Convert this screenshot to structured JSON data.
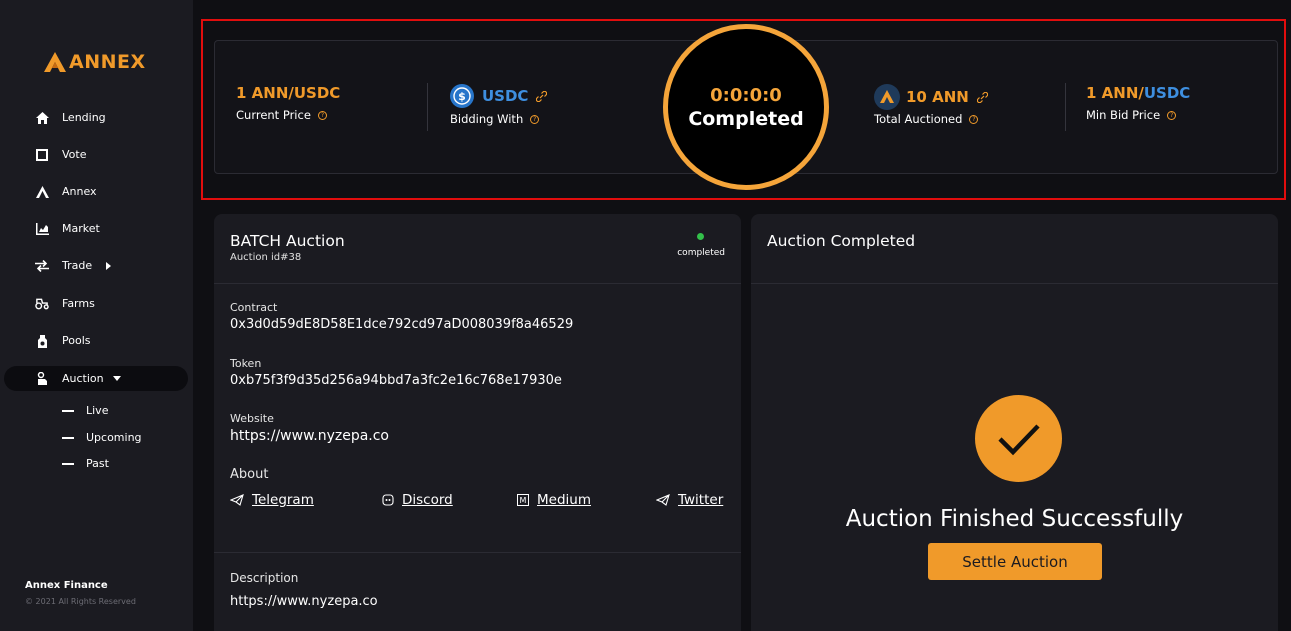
{
  "brand": {
    "name": "ANNEX"
  },
  "sidebar": {
    "items": [
      {
        "label": "Lending",
        "icon": "home-icon"
      },
      {
        "label": "Vote",
        "icon": "square-icon"
      },
      {
        "label": "Annex",
        "icon": "annex-logo-icon"
      },
      {
        "label": "Market",
        "icon": "chart-icon"
      },
      {
        "label": "Trade",
        "icon": "swap-icon"
      },
      {
        "label": "Farms",
        "icon": "tractor-icon"
      },
      {
        "label": "Pools",
        "icon": "pool-icon"
      },
      {
        "label": "Auction",
        "icon": "hand-icon"
      }
    ],
    "auction_sub": [
      "Live",
      "Upcoming",
      "Past"
    ],
    "footer_title": "Annex Finance",
    "footer_copy": "© 2021 All Rights Reserved"
  },
  "stats": {
    "current_price": {
      "value": "1 ANN/USDC",
      "label": "Current Price"
    },
    "bidding_with": {
      "value": "USDC",
      "label": "Bidding With"
    },
    "timer": {
      "time": "0:0:0:0",
      "status": "Completed"
    },
    "total_auctioned": {
      "value": "10 ANN",
      "label": "Total Auctioned"
    },
    "min_bid": {
      "value_orange": "1 ANN/",
      "value_blue": "USDC",
      "label": "Min Bid Price"
    }
  },
  "auction": {
    "title": "BATCH Auction",
    "id": "Auction id#38",
    "status": "completed",
    "contract_label": "Contract",
    "contract": "0x3d0d59dE8D58E1dce792cd97aD008039f8a46529",
    "token_label": "Token",
    "token": "0xb75f3f9d35d256a94bbd7a3fc2e16c768e17930e",
    "website_label": "Website",
    "website": "https://www.nyzepa.co",
    "about_label": "About",
    "socials": [
      "Telegram",
      "Discord",
      "Medium",
      "Twitter"
    ],
    "description_label": "Description",
    "description": "https://www.nyzepa.co"
  },
  "completed_panel": {
    "title": "Auction Completed",
    "message": "Auction Finished Successfully",
    "button": "Settle Auction"
  },
  "colors": {
    "accent": "#f09a2a",
    "blue": "#3e8fe0",
    "success": "#33c04a",
    "highlight": "#e10d0d"
  }
}
